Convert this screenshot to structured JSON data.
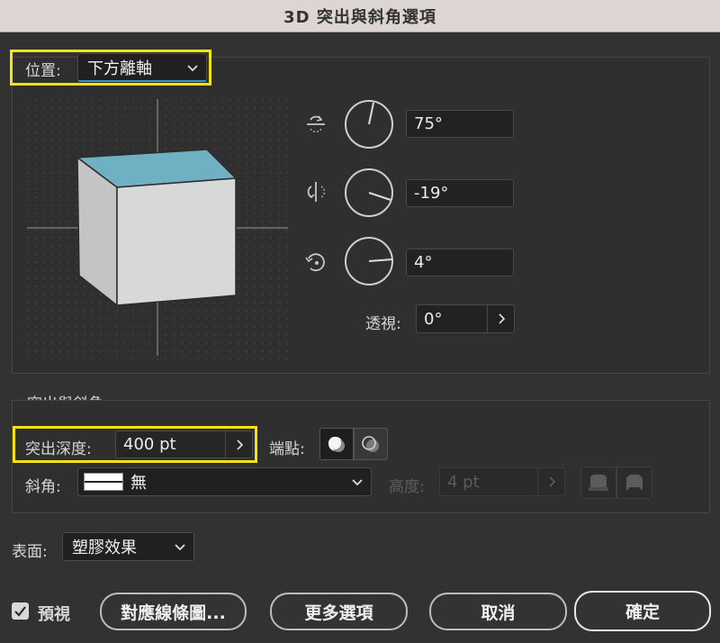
{
  "window": {
    "title": "3D 突出與斜角選項"
  },
  "position": {
    "label": "位置:",
    "value": "下方離軸"
  },
  "rotation": {
    "x_angle": "75°",
    "y_angle": "-19°",
    "z_angle": "4°",
    "x_icon": "rotate-x-axis-icon",
    "y_icon": "rotate-y-axis-icon",
    "z_icon": "rotate-z-axis-icon"
  },
  "perspective": {
    "label": "透視:",
    "value": "0°"
  },
  "extrude_section": {
    "title": "突出與斜角"
  },
  "extrude_depth": {
    "label": "突出深度:",
    "value": "400 pt"
  },
  "cap": {
    "label": "端點:"
  },
  "bevel": {
    "label": "斜角:",
    "value": "無"
  },
  "height": {
    "label": "高度:",
    "value": "4 pt"
  },
  "surface": {
    "label": "表面:",
    "value": "塑膠效果"
  },
  "footer": {
    "preview_label": "預視",
    "preview_checked": true,
    "map_art_label": "對應線條圖...",
    "more_options_label": "更多選項",
    "cancel_label": "取消",
    "ok_label": "確定"
  },
  "colors": {
    "cube_top": "#6fb0c2",
    "cube_front": "#d8d8d8",
    "cube_side": "#c4c4c4",
    "highlight": "#f4e214"
  }
}
